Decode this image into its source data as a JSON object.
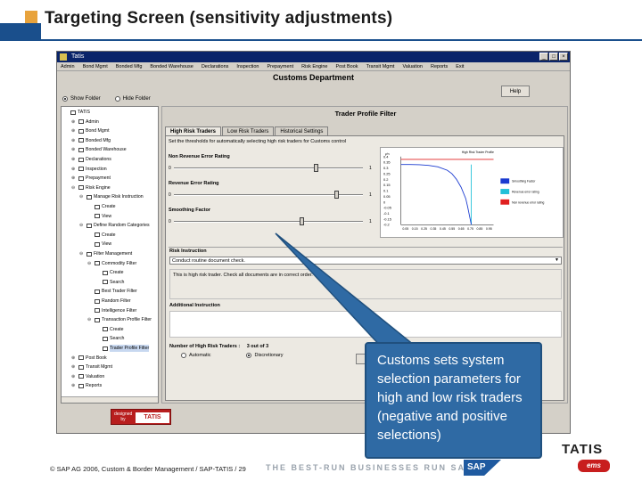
{
  "slide": {
    "title": "Targeting Screen (sensitivity adjustments)",
    "copyright": "© SAP AG 2006, Custom & Border Management / SAP-TATIS / 29",
    "tagline": "THE BEST-RUN BUSINESSES RUN SAP",
    "sap_logo_text": "SAP",
    "tatis_text": "TATIS",
    "ems_text": "ems"
  },
  "window": {
    "title": "Tatis",
    "menu": [
      "Admin",
      "Bond Mgmt",
      "Bonded Mfg",
      "Bonded Warehouse",
      "Declarations",
      "Inspection",
      "Prepayment",
      "Risk Engine",
      "Post Book",
      "Transit Mgmt",
      "Valuation",
      "Reports",
      "Exit"
    ],
    "department": "Customs Department",
    "help_label": "Help",
    "show_folder": "Show Folder",
    "hide_folder": "Hide Folder"
  },
  "tree": [
    {
      "label": "TATIS",
      "indent": 0,
      "expander": "",
      "selected": false
    },
    {
      "label": "Admin",
      "indent": 1,
      "expander": "+",
      "selected": false
    },
    {
      "label": "Bond Mgmt",
      "indent": 1,
      "expander": "+",
      "selected": false
    },
    {
      "label": "Bonded Mfg",
      "indent": 1,
      "expander": "+",
      "selected": false
    },
    {
      "label": "Bonded Warehouse",
      "indent": 1,
      "expander": "+",
      "selected": false
    },
    {
      "label": "Declarations",
      "indent": 1,
      "expander": "+",
      "selected": false
    },
    {
      "label": "Inspection",
      "indent": 1,
      "expander": "+",
      "selected": false
    },
    {
      "label": "Prepayment",
      "indent": 1,
      "expander": "+",
      "selected": false
    },
    {
      "label": "Risk Engine",
      "indent": 1,
      "expander": "-",
      "selected": false
    },
    {
      "label": "Manage Risk Instruction",
      "indent": 2,
      "expander": "-",
      "selected": false
    },
    {
      "label": "Create",
      "indent": 3,
      "expander": "",
      "selected": false
    },
    {
      "label": "View",
      "indent": 3,
      "expander": "",
      "selected": false
    },
    {
      "label": "Define Random Categories",
      "indent": 2,
      "expander": "-",
      "selected": false
    },
    {
      "label": "Create",
      "indent": 3,
      "expander": "",
      "selected": false
    },
    {
      "label": "View",
      "indent": 3,
      "expander": "",
      "selected": false
    },
    {
      "label": "Filter Management",
      "indent": 2,
      "expander": "-",
      "selected": false
    },
    {
      "label": "Commodity Filter",
      "indent": 3,
      "expander": "-",
      "selected": false
    },
    {
      "label": "Create",
      "indent": 4,
      "expander": "",
      "selected": false
    },
    {
      "label": "Search",
      "indent": 4,
      "expander": "",
      "selected": false
    },
    {
      "label": "Best Trader Filter",
      "indent": 3,
      "expander": "",
      "selected": false
    },
    {
      "label": "Random Filter",
      "indent": 3,
      "expander": "",
      "selected": false
    },
    {
      "label": "Intelligence Filter",
      "indent": 3,
      "expander": "",
      "selected": false
    },
    {
      "label": "Transaction Profile Filter",
      "indent": 3,
      "expander": "-",
      "selected": false
    },
    {
      "label": "Create",
      "indent": 4,
      "expander": "",
      "selected": false
    },
    {
      "label": "Search",
      "indent": 4,
      "expander": "",
      "selected": false
    },
    {
      "label": "Trader Profile Filter",
      "indent": 4,
      "expander": "",
      "selected": true
    },
    {
      "label": "Post Book",
      "indent": 1,
      "expander": "+",
      "selected": false
    },
    {
      "label": "Transit Mgmt",
      "indent": 1,
      "expander": "+",
      "selected": false
    },
    {
      "label": "Valuation",
      "indent": 1,
      "expander": "+",
      "selected": false
    },
    {
      "label": "Reports",
      "indent": 1,
      "expander": "+",
      "selected": false
    }
  ],
  "panel": {
    "title": "Trader Profile Filter",
    "tabs": [
      {
        "label": "High Risk Traders",
        "active": true
      },
      {
        "label": "Low Risk Traders",
        "active": false
      },
      {
        "label": "Historical Settings",
        "active": false
      }
    ],
    "description": "Set the thresholds for automatically selecting high risk traders for Customs control",
    "sliders": [
      {
        "label": "Non Revenue Error Rating",
        "min": "0",
        "max": "1",
        "value": 0.76
      },
      {
        "label": "Revenue Error Rating",
        "min": "0",
        "max": "1",
        "value": 0.87
      },
      {
        "label": "Smoothing Factor",
        "min": "0",
        "max": "1",
        "value": 0.68
      }
    ],
    "risk_instruction_label": "Risk Instruction",
    "risk_instruction_value": "Conduct routine document check.",
    "risk_instruction_text": "This is high risk trader. Check all documents are in correct order.",
    "additional_label": "Additional Instruction",
    "num_high_risk_label": "Number of High Risk Traders :",
    "num_high_risk_value": "3 out of 3",
    "mode_options": [
      "Automatic",
      "Discretionary"
    ],
    "mode_selected": 1,
    "save_label": "Save"
  },
  "chart_data": {
    "type": "line",
    "title": "High Risk Trader Profile",
    "yaxis_label": "y/n",
    "yticks": [
      "0.4",
      "0.35",
      "0.3",
      "0.25",
      "0.2",
      "0.15",
      "0.1",
      "0.05",
      "0",
      "-0.05",
      "-0.1",
      "-0.15",
      "-0.2"
    ],
    "xticks": [
      "0.05",
      "0.15",
      "0.25",
      "0.35",
      "0.45",
      "0.55",
      "0.65",
      "0.75",
      "0.85",
      "0.95"
    ],
    "legend": [
      {
        "name": "Smoothing Factor",
        "color": "#1a3ad0"
      },
      {
        "name": "Revenue error rating",
        "color": "#20c0d8"
      },
      {
        "name": "Non revenue error rating",
        "color": "#e02020"
      }
    ],
    "series": [
      {
        "name": "Non revenue error rating",
        "x": [
          0.0,
          1.0
        ],
        "y": [
          0.375,
          0.375
        ]
      },
      {
        "name": "Revenue error rating",
        "x": [
          0.76,
          0.76
        ],
        "y": [
          0.33,
          -0.2
        ]
      },
      {
        "name": "Smoothing Factor",
        "x": [
          0.0,
          0.1,
          0.2,
          0.3,
          0.4,
          0.5,
          0.55,
          0.6,
          0.65,
          0.7,
          0.72,
          0.74,
          0.76
        ],
        "y": [
          0.33,
          0.33,
          0.328,
          0.322,
          0.31,
          0.28,
          0.25,
          0.2,
          0.13,
          0.03,
          -0.04,
          -0.12,
          -0.2
        ]
      }
    ],
    "xlim": [
      0,
      1
    ],
    "ylim": [
      -0.2,
      0.4
    ]
  },
  "callout": {
    "text": "Customs sets system selection parameters for high and low risk traders (negative and positive selections)"
  },
  "designed_by": {
    "label": "designed by",
    "brand": "TATIS"
  },
  "colors": {
    "callout_bg": "#2f6aa4",
    "title_bar": "#0a246a",
    "accent_orange": "#e8a33c",
    "accent_blue": "#1a4f8c"
  }
}
